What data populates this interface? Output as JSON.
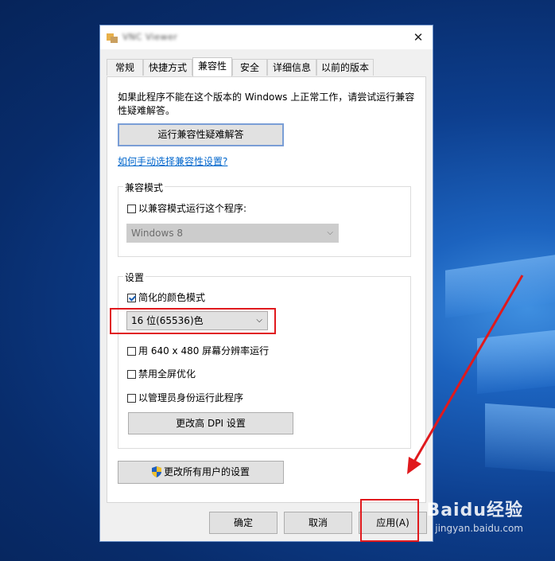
{
  "window": {
    "title": "VNC Viewer"
  },
  "tabs": [
    "常规",
    "快捷方式",
    "兼容性",
    "安全",
    "详细信息",
    "以前的版本"
  ],
  "intro_text": "如果此程序不能在这个版本的 Windows 上正常工作，请尝试运行兼容性疑难解答。",
  "troubleshoot_button": "运行兼容性疑难解答",
  "manual_link": "如何手动选择兼容性设置?",
  "compat_group": {
    "title": "兼容模式",
    "checkbox": "以兼容模式运行这个程序:",
    "os_select": "Windows 8"
  },
  "settings_group": {
    "title": "设置",
    "reduced_color": "简化的颜色模式",
    "color_select": "16 位(65536)色",
    "res_640": "用 640 x 480 屏幕分辨率运行",
    "disable_fullscreen": "禁用全屏优化",
    "run_as_admin": "以管理员身份运行此程序",
    "dpi_button": "更改高 DPI 设置"
  },
  "all_users_button": "更改所有用户的设置",
  "footer": {
    "ok": "确定",
    "cancel": "取消",
    "apply": "应用(A)"
  },
  "watermark": {
    "logo": "Baidu经验",
    "url": "jingyan.baidu.com"
  },
  "colors": {
    "annotation": "#e0191d",
    "link": "#0066cc",
    "desktop": "#0d3f8f"
  }
}
